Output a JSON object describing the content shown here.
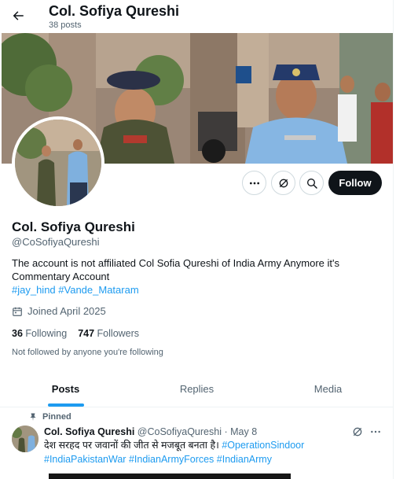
{
  "header": {
    "title": "Col. Sofiya Qureshi",
    "posts_count": "38 posts"
  },
  "profile": {
    "name": "Col. Sofiya Qureshi",
    "handle": "@CoSofiyaQureshi",
    "bio": "The account is not affiliated Col Sofia Qureshi of India Army Anymore it's Commentary Account",
    "bio_tags": [
      "#jay_hind",
      "#Vande_Mataram"
    ],
    "joined": "Joined April 2025",
    "following_count": "36",
    "following_label": "Following",
    "followers_count": "747",
    "followers_label": "Followers",
    "not_followed": "Not followed by anyone you're following",
    "follow_label": "Follow"
  },
  "tabs": [
    {
      "label": "Posts",
      "active": true
    },
    {
      "label": "Replies",
      "active": false
    },
    {
      "label": "Media",
      "active": false
    }
  ],
  "pinned_post": {
    "pinned_label": "Pinned",
    "author_name": "Col. Sofiya Qureshi",
    "author_handle": "@CoSofiyaQureshi",
    "separator": "·",
    "date": "May 8",
    "text": "देश सरहद पर जवानों की जीत से मजबूत बनता है।",
    "hashtags_line1": "#OperationSindoor",
    "hashtags_line2": [
      "#IndiaPakistanWar",
      "#IndianArmyForces",
      "#IndianArmy"
    ]
  },
  "icons": {
    "back": "arrow-left-icon",
    "more": "more-dots-icon",
    "grok": "grok-icon",
    "search": "search-icon",
    "calendar": "calendar-icon",
    "pin": "pin-icon"
  },
  "colors": {
    "accent": "#1d9bf0",
    "text_primary": "#0f1419",
    "text_secondary": "#536471",
    "follow_bg": "#0f1419"
  }
}
